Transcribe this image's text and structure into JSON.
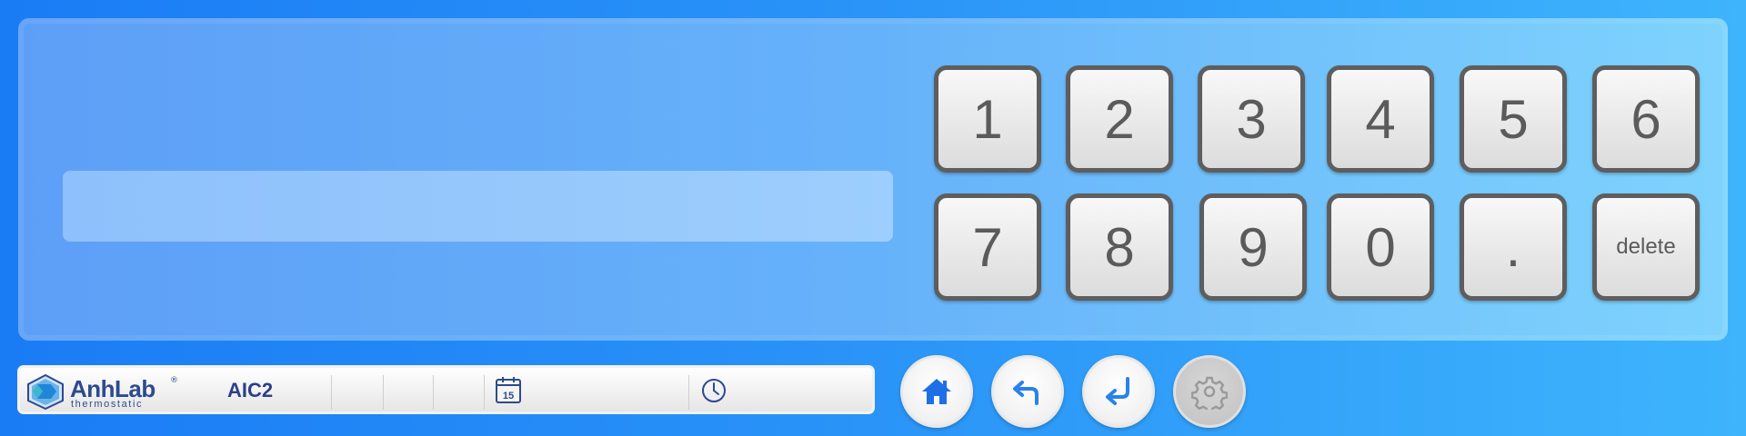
{
  "entry": {
    "value": ""
  },
  "keypad": {
    "keys": [
      {
        "label": "1"
      },
      {
        "label": "2"
      },
      {
        "label": "3"
      },
      {
        "label": "4"
      },
      {
        "label": "5"
      },
      {
        "label": "6"
      },
      {
        "label": "7"
      },
      {
        "label": "8"
      },
      {
        "label": "9"
      },
      {
        "label": "0"
      },
      {
        "label": "."
      },
      {
        "label": "delete"
      }
    ]
  },
  "status_bar": {
    "brand": {
      "name": "AnhLab",
      "registered": "®",
      "tagline": "thermostatic"
    },
    "device_id": "AIC2",
    "calendar_day": "15"
  },
  "nav": {
    "home_icon": "home-icon",
    "back_icon": "back-arrow-icon",
    "enter_icon": "enter-icon",
    "settings_icon": "gear-icon"
  },
  "colors": {
    "icon_blue": "#1e6fe6",
    "brand_navy": "#2d4a8f",
    "key_border": "#5e5e5e"
  }
}
